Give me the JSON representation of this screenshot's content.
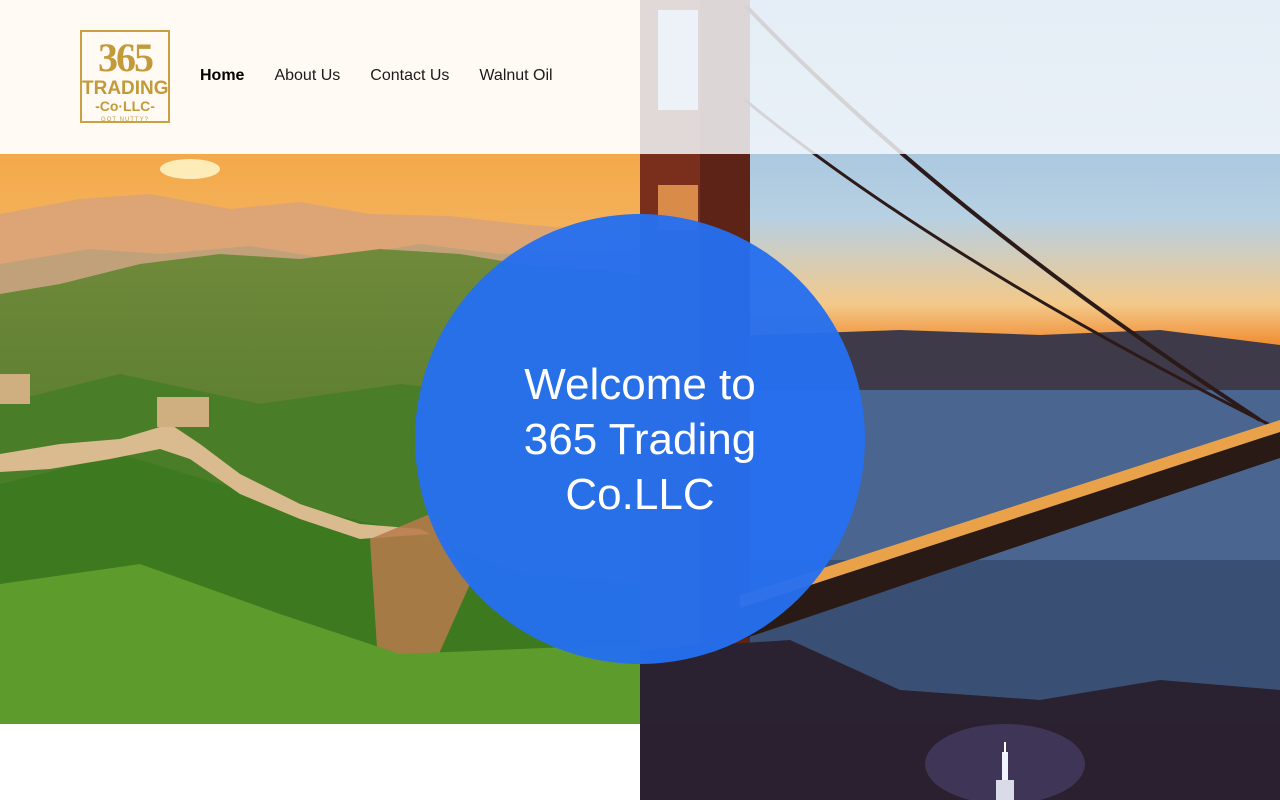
{
  "header": {
    "logo": {
      "number": "365",
      "word": "TRADING",
      "company": "-Co·LLC-",
      "tagline": "GOT NUTTY?",
      "color": "#c29a3a",
      "icon": "company-logo"
    },
    "nav": [
      {
        "label": "Home",
        "active": true
      },
      {
        "label": "About Us",
        "active": false
      },
      {
        "label": "Contact Us",
        "active": false
      },
      {
        "label": "Walnut Oil",
        "active": false
      }
    ]
  },
  "hero": {
    "title": "Welcome to 365 Trading Co.LLC",
    "circle_color": "#256fef"
  },
  "images": [
    {
      "subject": "great-wall-of-china"
    },
    {
      "subject": "golden-gate-bridge-sunset"
    },
    {
      "subject": "empire-state-building-night"
    }
  ]
}
